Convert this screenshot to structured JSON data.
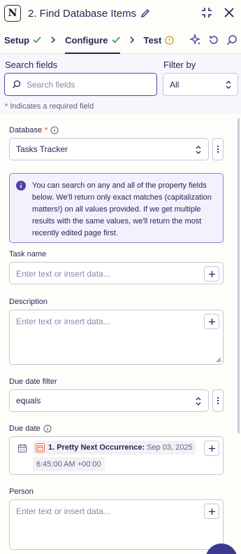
{
  "header": {
    "logo_letter": "N",
    "title": "2. Find Database Items",
    "icons": [
      "pencil-icon",
      "collapse-icon",
      "close-icon"
    ]
  },
  "tabs": [
    {
      "label": "Setup",
      "status": "complete"
    },
    {
      "label": "Configure",
      "status": "complete"
    },
    {
      "label": "Test",
      "status": "warning"
    }
  ],
  "tab_icons": [
    "sparkle-icon",
    "refresh-icon",
    "search-icon"
  ],
  "search": {
    "label": "Search fields",
    "placeholder": "Search fields",
    "filter_label": "Filter by",
    "filter_value": "All"
  },
  "required_note": {
    "asterisk": "*",
    "text": "Indicates a required field"
  },
  "database": {
    "label": "Database",
    "asterisk": "*",
    "value": "Tasks Tracker"
  },
  "info_text": "You can search on any and all of the property fields below. We'll return only exact matches (capitalization matters!) on all values provided. If we get multiple results with the same values, we'll return the most recently edited page first.",
  "task_name": {
    "label": "Task name",
    "placeholder": "Enter text or insert data..."
  },
  "description": {
    "label": "Description",
    "placeholder": "Enter text or insert data..."
  },
  "due_date_filter": {
    "label": "Due date filter",
    "value": "equals"
  },
  "due_date": {
    "label": "Due date",
    "step_label": "1. Pretty Next Occurrence:",
    "step_value": "Sep 03, 2025",
    "time_value": "6:45:00 AM +00:00"
  },
  "person": {
    "label": "Person",
    "placeholder": "Enter text or insert data..."
  },
  "colors": {
    "accent": "#4d45a5",
    "check": "#2e8b57",
    "warning": "#c9a227",
    "required": "#d23b2b",
    "step_icon": "#e8692b"
  }
}
